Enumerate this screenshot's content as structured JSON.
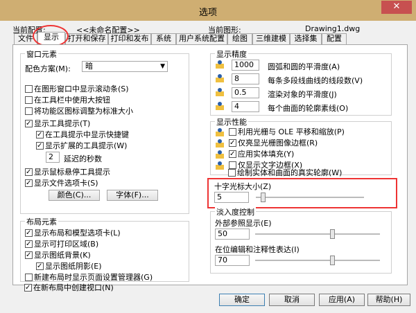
{
  "window": {
    "title": "选项",
    "close_glyph": "✕"
  },
  "current": {
    "profile_label": "当前配置:",
    "profile_value": "<<未命名配置>>",
    "drawing_label": "当前图形:",
    "drawing_value": "Drawing1.dwg"
  },
  "tabs": [
    {
      "label": "文件"
    },
    {
      "label": "显示"
    },
    {
      "label": "打开和保存"
    },
    {
      "label": "打印和发布"
    },
    {
      "label": "系统"
    },
    {
      "label": "用户系统配置"
    },
    {
      "label": "绘图"
    },
    {
      "label": "三维建模"
    },
    {
      "label": "选择集"
    },
    {
      "label": "配置"
    }
  ],
  "window_elements": {
    "title": "窗口元素",
    "color_scheme_label": "配色方案(M):",
    "color_scheme_value": "暗",
    "scrollbars": "在图形窗口中显示滚动条(S)",
    "large_buttons": "在工具栏中使用大按钮",
    "resize_ribbon": "将功能区图标调整为标准大小",
    "tooltips": "显示工具提示(T)",
    "shortcut_keys": "在工具提示中显示快捷键",
    "extended_tooltips": "显示扩展的工具提示(W)",
    "delay_value": "2",
    "delay_label": "延迟的秒数",
    "rollover_tooltips": "显示鼠标悬停工具提示",
    "file_tabs": "显示文件选项卡(S)",
    "colors_button": "颜色(C)...",
    "fonts_button": "字体(F)..."
  },
  "layout_elements": {
    "title": "布局元素",
    "layout_model_tabs": "显示布局和模型选项卡(L)",
    "printable_area": "显示可打印区域(B)",
    "paper_background": "显示图纸背景(K)",
    "paper_shadow": "显示图纸阴影(E)",
    "page_setup_manager": "新建布局时显示页面设置管理器(G)",
    "create_viewport": "在新布局中创建视口(N)"
  },
  "display_resolution": {
    "title": "显示精度",
    "arc_value": "1000",
    "arc_label": "圆弧和圆的平滑度(A)",
    "polyline_value": "8",
    "polyline_label": "每条多段线曲线的线段数(V)",
    "render_value": "0.5",
    "render_label": "渲染对象的平滑度(J)",
    "contour_value": "4",
    "contour_label": "每个曲面的轮廓素线(O)"
  },
  "display_performance": {
    "title": "显示性能",
    "pan_zoom_ole": "利用光栅与 OLE 平移和缩放(P)",
    "highlight_raster": "仅亮显光栅图像边框(R)",
    "solid_fill": "应用实体填充(Y)",
    "text_boundary": "仅显示文字边框(X)",
    "silhouettes": "绘制实体和曲面的真实轮廓(W)"
  },
  "crosshair": {
    "title": "十字光标大小(Z)",
    "value": "5",
    "slider_fraction": 0.05
  },
  "fade_control": {
    "title": "淡入度控制",
    "xref_label": "外部参照显示(E)",
    "xref_value": "50",
    "inplace_label": "在位编辑和注释性表达(I)",
    "inplace_value": "70"
  },
  "footer": {
    "ok": "确定",
    "cancel": "取消",
    "apply": "应用(A)",
    "help": "帮助(H)"
  }
}
